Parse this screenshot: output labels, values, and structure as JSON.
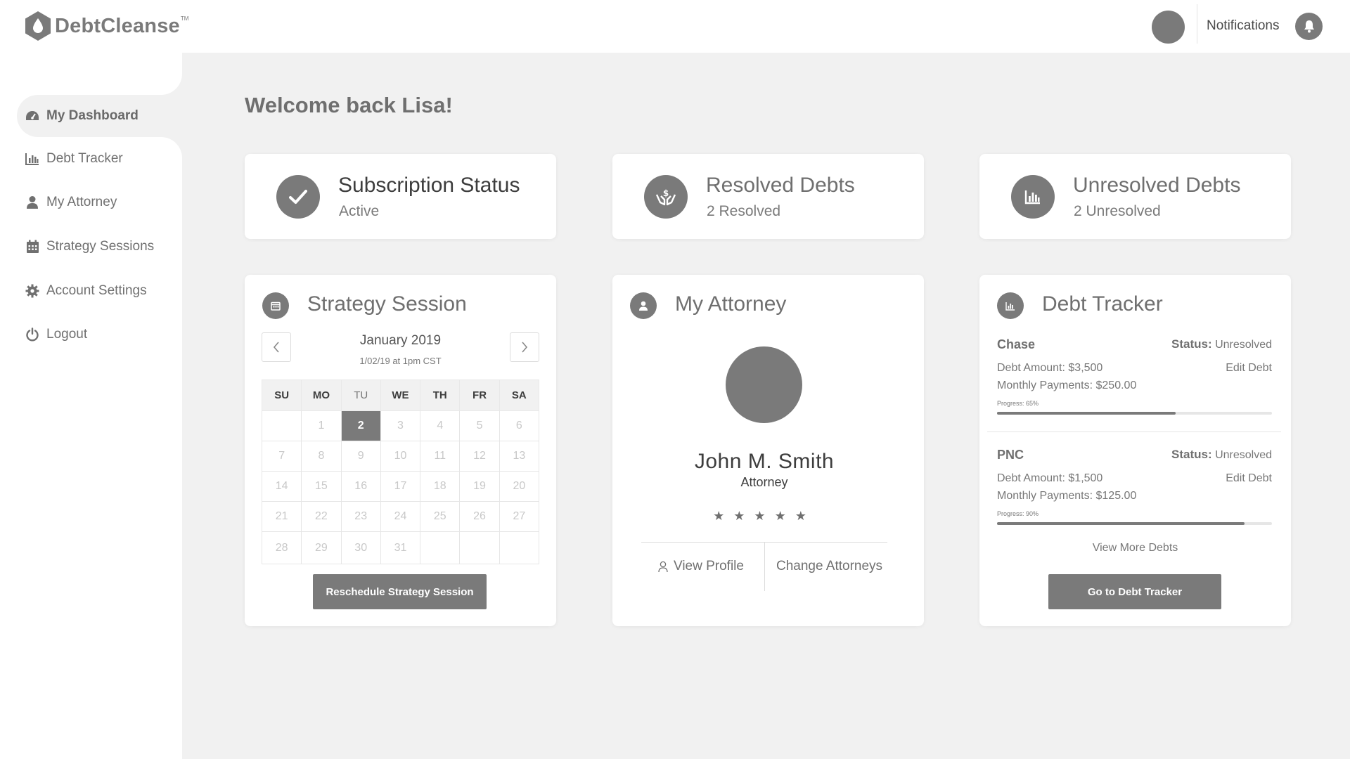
{
  "header": {
    "brand": "DebtCleanse",
    "trademark": "TM",
    "notifications_label": "Notifications"
  },
  "sidebar": {
    "items": [
      {
        "label": "My Dashboard",
        "icon": "dashboard-icon",
        "active": true
      },
      {
        "label": "Debt Tracker",
        "icon": "bar-chart-icon",
        "active": false
      },
      {
        "label": "My Attorney",
        "icon": "user-icon",
        "active": false
      },
      {
        "label": "Strategy Sessions",
        "icon": "calendar-icon",
        "active": false
      },
      {
        "label": "Account Settings",
        "icon": "gear-icon",
        "active": false
      },
      {
        "label": "Logout",
        "icon": "power-icon",
        "active": false
      }
    ]
  },
  "main": {
    "welcome": "Welcome back Lisa!",
    "status_cards": [
      {
        "title": "Subscription Status",
        "value": "Active",
        "icon": "check-icon"
      },
      {
        "title": "Resolved Debts",
        "value": "2 Resolved",
        "icon": "hands-dollar-icon"
      },
      {
        "title": "Unresolved Debts",
        "value": "2 Unresolved",
        "icon": "bar-chart-icon"
      }
    ],
    "strategy": {
      "title": "Strategy Session",
      "month": "January 2019",
      "session_date": "1/02/19 at 1pm CST",
      "weekdays": [
        "SU",
        "MO",
        "TU",
        "WE",
        "TH",
        "FR",
        "SA"
      ],
      "weeks": [
        [
          "",
          "1",
          "2",
          "3",
          "4",
          "5",
          "6"
        ],
        [
          "7",
          "8",
          "9",
          "10",
          "11",
          "12",
          "13"
        ],
        [
          "14",
          "15",
          "16",
          "17",
          "18",
          "19",
          "20"
        ],
        [
          "21",
          "22",
          "23",
          "24",
          "25",
          "26",
          "27"
        ],
        [
          "28",
          "29",
          "30",
          "31",
          "",
          "",
          ""
        ]
      ],
      "selected_day": "2",
      "button": "Reschedule Strategy Session"
    },
    "attorney": {
      "title": "My Attorney",
      "name": "John M. Smith",
      "role": "Attorney",
      "rating": 5,
      "stars": "★★★★★",
      "view_profile": "View Profile",
      "change": "Change Attorneys"
    },
    "debt_tracker": {
      "title": "Debt Tracker",
      "status_label": "Status:",
      "edit_label": "Edit Debt",
      "debts": [
        {
          "name": "Chase",
          "status": "Unresolved",
          "amount": "Debt Amount: $3,500",
          "monthly": "Monthly Payments: $250.00",
          "progress_label": "Progress: 65%",
          "progress": 65
        },
        {
          "name": "PNC",
          "status": "Unresolved",
          "amount": "Debt Amount: $1,500",
          "monthly": "Monthly Payments: $125.00",
          "progress_label": "Progress: 90%",
          "progress": 90
        }
      ],
      "view_more": "View More Debts",
      "button": "Go to Debt Tracker"
    }
  },
  "colors": {
    "accent_gray": "#7a7a7a",
    "background": "#f1f1f1"
  }
}
